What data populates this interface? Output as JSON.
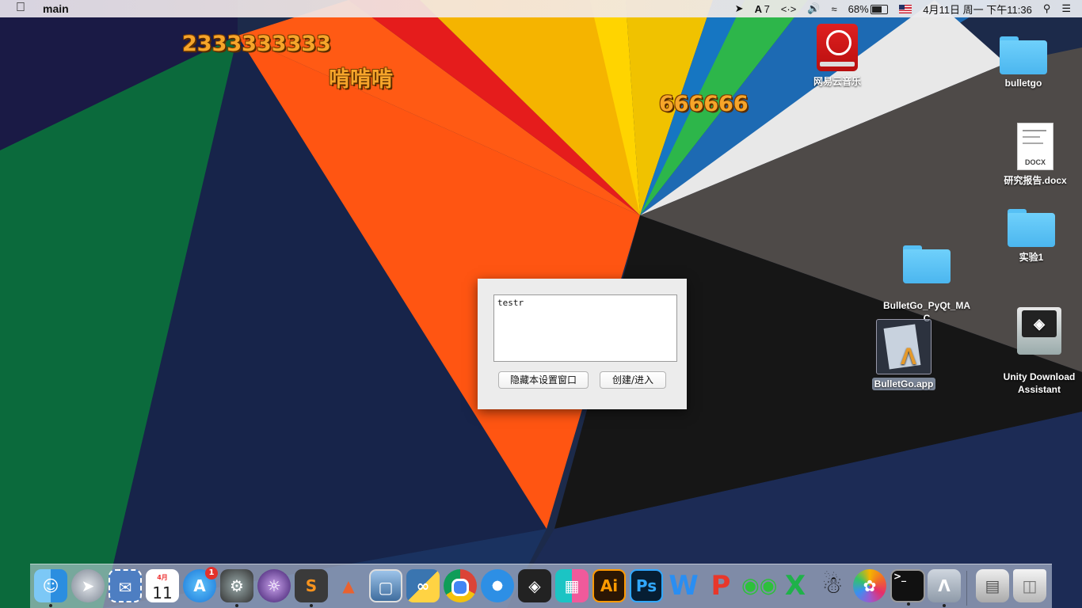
{
  "menubar": {
    "app_name": "main",
    "status": {
      "ime_count": "7",
      "battery": "68%",
      "battery_level": 0.68,
      "datetime": "4月11日 周一 下午11:36"
    }
  },
  "danmaku": [
    "2333333333",
    "啃啃啃",
    "666666"
  ],
  "desktop_icons": {
    "netease": "网易云音乐",
    "bulletgo_folder": "bulletgo",
    "report_docx": "研究报告.docx",
    "docx_badge": "DOCX",
    "experiment": "实验1",
    "pyqt_folder": "BulletGo_PyQt_MA\nC",
    "bulletgo_app": "BulletGo.app",
    "unity": "Unity Download\nAssistant"
  },
  "dialog": {
    "textarea_value": "testr",
    "hide_button": "隐藏本设置窗口",
    "create_button": "创建/进入"
  },
  "dock": {
    "items": [
      "finder-icon",
      "launchpad-icon",
      "mail-stamp-icon",
      "calendar-icon",
      "app-store-icon",
      "system-preferences-icon",
      "eclipse-icon",
      "sublime-text-icon",
      "matlab-icon",
      "preview-icon",
      "python-icon",
      "chrome-icon",
      "safari-icon",
      "unity-icon",
      "xmind-icon",
      "illustrator-icon",
      "photoshop-icon",
      "word-icon",
      "powerpoint-icon",
      "wechat-icon",
      "excel-icon",
      "qq-icon",
      "photos-icon",
      "terminal-icon",
      "xcode-app-icon",
      "downloads-stack-icon",
      "trash-icon"
    ],
    "calendar_month": "4月",
    "calendar_day": "11",
    "app_store_badge": "1",
    "illustrator_label": "Ai",
    "photoshop_label": "Ps",
    "word_label": "W",
    "powerpoint_label": "P",
    "excel_label": "X"
  },
  "colors": {
    "danmaku": "#f6a52a",
    "folder": "#5ec6f8"
  }
}
